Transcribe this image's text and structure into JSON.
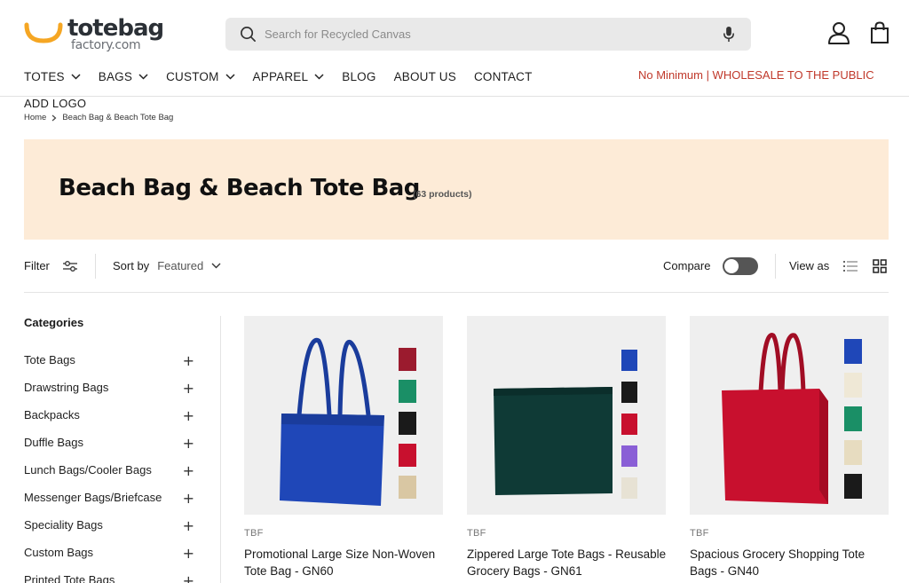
{
  "brand": {
    "logo_main": "totebag",
    "logo_sub": "factory.com"
  },
  "search": {
    "placeholder": "Search for Recycled Canvas"
  },
  "nav": {
    "items": [
      {
        "label": "TOTES",
        "has_dropdown": true
      },
      {
        "label": "BAGS",
        "has_dropdown": true
      },
      {
        "label": "CUSTOM",
        "has_dropdown": true
      },
      {
        "label": "APPAREL",
        "has_dropdown": true
      },
      {
        "label": "BLOG",
        "has_dropdown": false
      },
      {
        "label": "ABOUT US",
        "has_dropdown": false
      },
      {
        "label": "CONTACT",
        "has_dropdown": false
      }
    ],
    "overflow_item": "ADD LOGO",
    "promo": "No Minimum | WHOLESALE TO THE PUBLIC"
  },
  "breadcrumb": {
    "home": "Home",
    "current": "Beach Bag & Beach Tote Bag"
  },
  "collection": {
    "title": "Beach Bag & Beach Tote Bag",
    "count": "(63 products)"
  },
  "toolbar": {
    "filter_label": "Filter",
    "sort_label": "Sort by",
    "sort_value": "Featured",
    "compare_label": "Compare",
    "view_label": "View as"
  },
  "sidebar": {
    "heading": "Categories",
    "items": [
      "Tote Bags",
      "Drawstring Bags",
      "Backpacks",
      "Duffle Bags",
      "Lunch Bags/Cooler Bags",
      "Messenger Bags/Briefcase",
      "Speciality Bags",
      "Custom Bags",
      "Printed Tote Bags"
    ]
  },
  "products": [
    {
      "vendor": "TBF",
      "title": "Promotional Large Size Non-Woven Tote Bag - GN60",
      "main_color": "#1f47b8",
      "swatches": [
        "#9b1b2e",
        "#1a8f66",
        "#1a1a1a",
        "#c8102e",
        "#d9c7a3"
      ]
    },
    {
      "vendor": "TBF",
      "title": "Zippered Large Tote Bags - Reusable Grocery Bags - GN61",
      "main_color": "#0f3a36",
      "swatches": [
        "#1f47b8",
        "#1a1a1a",
        "#c8102e",
        "#8a5fd6",
        "#e7e2d4"
      ]
    },
    {
      "vendor": "TBF",
      "title": "Spacious Grocery Shopping Tote Bags - GN40",
      "main_color": "#c8102e",
      "swatches": [
        "#1f47b8",
        "#efe8d6",
        "#1a8f66",
        "#e7dcc0",
        "#1a1a1a"
      ]
    }
  ],
  "colors": {
    "accent_orange": "#f5a623",
    "promo_red": "#c0392b",
    "hero_bg": "#fdebd7"
  }
}
